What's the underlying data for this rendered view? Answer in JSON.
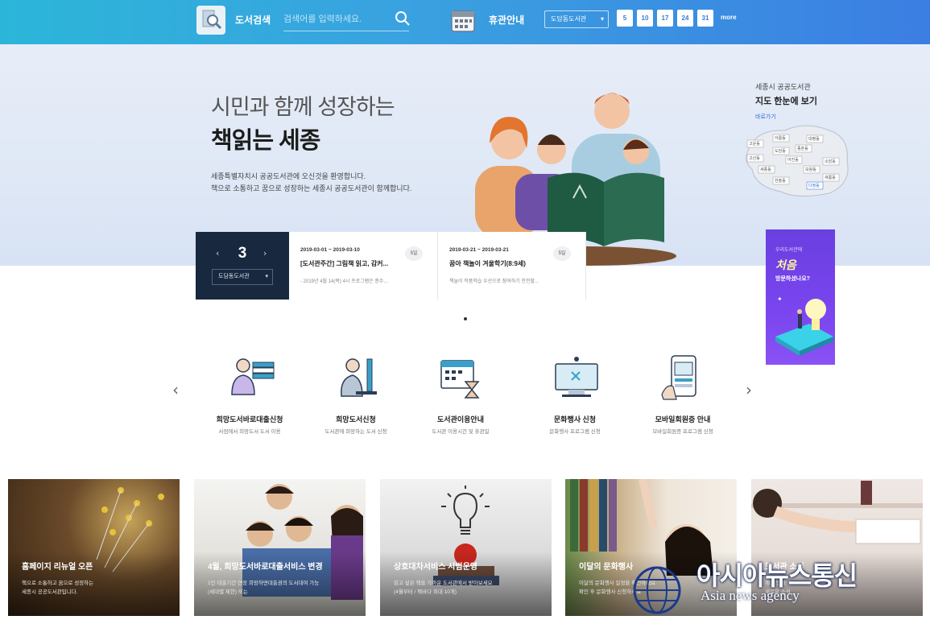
{
  "topbar": {
    "search_label": "도서검색",
    "search_placeholder": "검색어를 입력하세요.",
    "closed_label": "휴관안내",
    "library_select": "도담동도서관",
    "closed_days": [
      "5",
      "10",
      "17",
      "24",
      "31"
    ],
    "more_label": "more"
  },
  "hero": {
    "subtitle": "시민과 함께 성장하는",
    "title": "책읽는 세종",
    "desc_line1": "세종특별자치시 공공도서관에 오신것을 환영합니다.",
    "desc_line2": "책으로 소통하고 꿈으로 성장하는 세종시 공공도서관이 함께합니다."
  },
  "map": {
    "caption_top": "세종시 공공도서관",
    "caption_title": "지도 한눈에 보기",
    "link": "바로가기",
    "labels": [
      "고운동",
      "아름동",
      "종촌동",
      "도담동",
      "어진동",
      "세종동",
      "보람동",
      "한솔동",
      "새롬동",
      "다정동",
      "고산동",
      "대평동",
      "소담동"
    ]
  },
  "events": {
    "month": "3",
    "prev": "‹",
    "next": "›",
    "library_select": "도담동도서관",
    "items": [
      {
        "date": "2019-03-01 ~ 2019-03-10",
        "dday": "5일",
        "title": "[도서관주간] 그림책 읽고, 감커...",
        "desc": "- 2019년 4월 14(목) 4시 프로그램은 종수..."
      },
      {
        "date": "2019-03-21 ~ 2019-03-21",
        "dday": "5일",
        "title": "꿈아 책놀이 겨울학기(8:9세)",
        "desc": "책놀이 작품학습 우선으로 참여하기 안전할..."
      }
    ]
  },
  "side_banner": {
    "small": "우리도서관에",
    "big": "처음",
    "question": "방문하셨나요?"
  },
  "quick_menu": {
    "prev": "‹",
    "next": "›",
    "items": [
      {
        "label": "희망도서바로대출신청",
        "sub": "서점에서 희망도서 도서 이용",
        "icon": "person-books-icon"
      },
      {
        "label": "희망도서신청",
        "sub": "도서관에 희망하는 도서 신청",
        "icon": "person-computer-icon"
      },
      {
        "label": "도서관이용안내",
        "sub": "도서관 이용시간 및 휴관일",
        "icon": "calendar-hourglass-icon"
      },
      {
        "label": "문화행사 신청",
        "sub": "문화행사 프로그램 신청",
        "icon": "monitor-icon"
      },
      {
        "label": "모바일회원증 안내",
        "sub": "모바일회원증 프로그램 신청",
        "icon": "mobile-card-icon"
      }
    ]
  },
  "cards": [
    {
      "title": "홈페이지 리뉴얼 오픈",
      "desc1": "책으로 소통하고 꿈으로 성장하는",
      "desc2": "세종시 공공도서관입니다."
    },
    {
      "title": "4월, 희망도서바로대출서비스 변경",
      "desc1": "1인 대출기간 연장 희망하면대출권의 도서대여 가능",
      "desc2": "(세대별 제한) 또는"
    },
    {
      "title": "상호대차서비스 시범운영",
      "desc1": "읽고 싶은 책을 가까운 도서관에서 받아보세요",
      "desc2": "(4월부터 / 책바다 최대 10개)"
    },
    {
      "title": "이달의 문화행사",
      "desc1": "이달의 문화행사 일정을 확인하세요",
      "desc2": "확인 후 문화행사 신청하세요"
    },
    {
      "title": "도서관 소식",
      "desc1": "개관 안내",
      "desc2": "새로운 소식"
    }
  ],
  "watermark": {
    "main": "아시아뉴스통신",
    "sub": "Asia news agency"
  }
}
